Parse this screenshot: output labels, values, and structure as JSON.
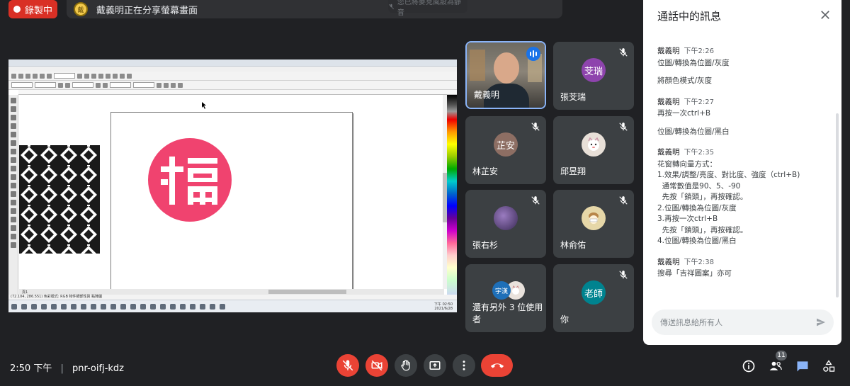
{
  "top_bar": {
    "recording_label": "錄製中",
    "presenter_text": "戴義明正在分享螢幕畫面",
    "presenter_avatar_text": "戴",
    "ghost_toast": "您已將麥克風設為靜音"
  },
  "shared_screen": {
    "page_tab": "頁1",
    "status_text": "(72.104, 286.551)  色彩模式: RGB  物件細部性質  點陣圖",
    "clock_time": "下午 02:50",
    "clock_date": "2021/6/28"
  },
  "participants": [
    {
      "name": "戴義明",
      "avatar_text": "",
      "avatar_color": "#5f7a8a",
      "muted": false,
      "speaking": true,
      "active": true
    },
    {
      "name": "張芠瑞",
      "avatar_text": "芠瑞",
      "avatar_color": "#8e44ad",
      "muted": true,
      "speaking": false,
      "active": false
    },
    {
      "name": "林芷安",
      "avatar_text": "芷安",
      "avatar_color": "#8d6e63",
      "muted": true,
      "speaking": false,
      "active": false
    },
    {
      "name": "邱昱翔",
      "avatar_text": "",
      "avatar_color": "#e8e0d8",
      "muted": true,
      "speaking": false,
      "active": false
    },
    {
      "name": "張右杉",
      "avatar_text": "",
      "avatar_color": "#4a3a6a",
      "muted": true,
      "speaking": false,
      "active": false
    },
    {
      "name": "林俞佑",
      "avatar_text": "",
      "avatar_color": "#e6d7a8",
      "muted": true,
      "speaking": false,
      "active": false
    },
    {
      "name": "還有另外 3 位使用者",
      "avatar_text": "宇漢",
      "avatar_color": "#1e6fb8",
      "muted": false,
      "speaking": false,
      "active": false
    },
    {
      "name": "你",
      "avatar_text": "老師",
      "avatar_color": "#00838f",
      "muted": true,
      "speaking": false,
      "active": false
    }
  ],
  "chat": {
    "title": "通話中的訊息",
    "input_placeholder": "傳送訊息給所有人",
    "messages": [
      {
        "sender": "戴義明",
        "time": "下午2:26",
        "lines": [
          "位圖/轉換為位圖/灰度",
          "",
          "將顏色模式/灰度"
        ]
      },
      {
        "sender": "戴義明",
        "time": "下午2:27",
        "lines": [
          "再按一次ctrl+B",
          "",
          "位圖/轉換為位圖/黑白"
        ]
      },
      {
        "sender": "戴義明",
        "time": "下午2:35",
        "lines": [
          "花窗轉向量方式：",
          "1.效果/調整/亮度、對比度、強度（ctrl+B)",
          "  通常數值是90、5、-90",
          "  先按「鎖頭」，再按確認。",
          "2.位圖/轉換為位圖/灰度",
          "3.再按一次ctrl+B",
          "  先按「鎖頭」，再按確認。",
          "4.位圖/轉換為位圖/黑白"
        ]
      },
      {
        "sender": "戴義明",
        "time": "下午2:38",
        "lines": [
          "搜尋「吉祥圖案」亦可"
        ]
      }
    ]
  },
  "bottom_bar": {
    "time": "2:50 下午",
    "separator": "|",
    "meeting_code": "pnr-oifj-kdz",
    "participant_count": "11"
  },
  "colors": {
    "background": "#202124",
    "tile": "#3c4043",
    "red": "#ea4335",
    "accent_blue": "#8ab4f8",
    "seal_pink": "#f0436f"
  }
}
